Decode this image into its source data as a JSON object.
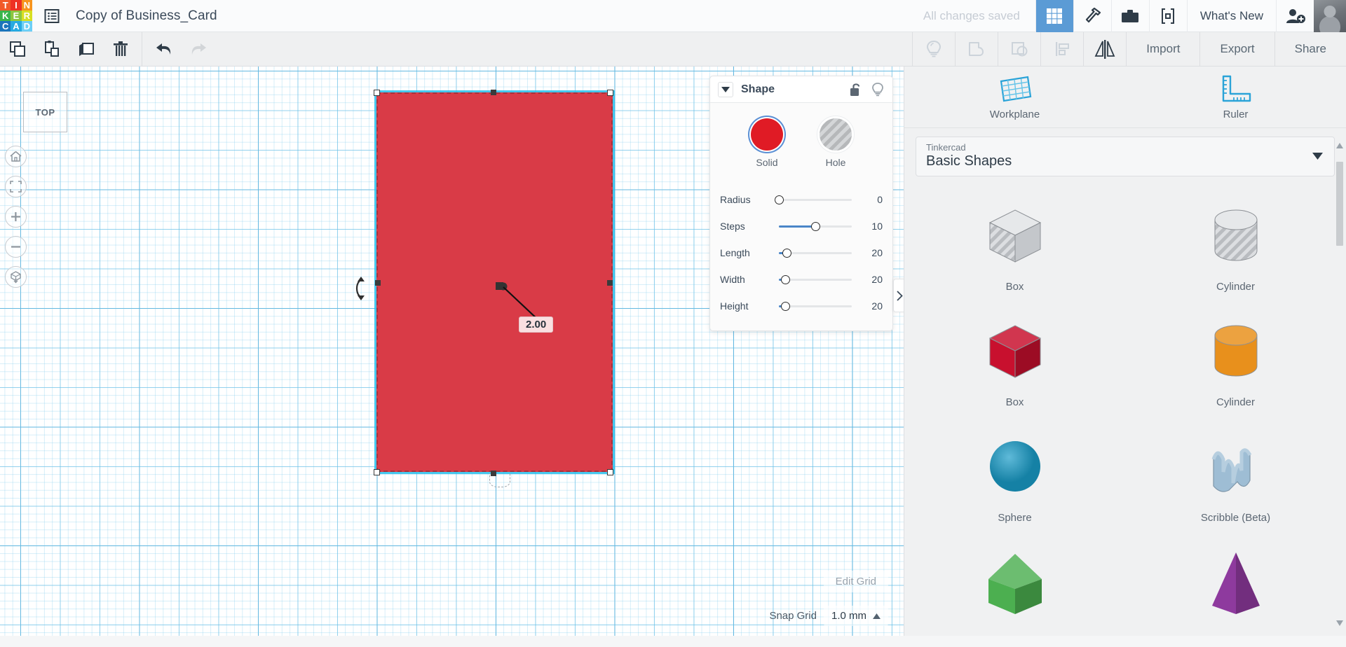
{
  "header": {
    "logo_tiles": [
      {
        "letter": "T",
        "color": "#f15a29"
      },
      {
        "letter": "I",
        "color": "#ee3124"
      },
      {
        "letter": "N",
        "color": "#f7941e"
      },
      {
        "letter": "K",
        "color": "#39b54a"
      },
      {
        "letter": "E",
        "color": "#8cc63f"
      },
      {
        "letter": "R",
        "color": "#d7df23"
      },
      {
        "letter": "C",
        "color": "#1b75bb"
      },
      {
        "letter": "A",
        "color": "#27aae1"
      },
      {
        "letter": "D",
        "color": "#6dcff6"
      }
    ],
    "menu_icon": "list-menu-icon",
    "title": "Copy of Business_Card",
    "save_status": "All changes saved",
    "buttons": [
      {
        "name": "grid-view-button",
        "icon": "grid-icon",
        "active": true
      },
      {
        "name": "codeblocks-button",
        "icon": "hammer-icon",
        "active": false
      },
      {
        "name": "gallery-button",
        "icon": "briefcase-icon",
        "active": false
      },
      {
        "name": "blocks-button",
        "icon": "code-brackets-icon",
        "active": false
      }
    ],
    "whats_new": "What's New",
    "invite_icon": "add-person-icon",
    "avatar": "user-avatar"
  },
  "toolbar": {
    "left_buttons": [
      {
        "name": "copy-button",
        "icon": "copy-icon"
      },
      {
        "name": "paste-button",
        "icon": "paste-icon"
      },
      {
        "name": "duplicate-button",
        "icon": "duplicate-icon"
      },
      {
        "name": "delete-button",
        "icon": "trash-icon"
      }
    ],
    "history_buttons": [
      {
        "name": "undo-button",
        "icon": "undo-arrow-icon"
      },
      {
        "name": "redo-button",
        "icon": "redo-arrow-icon"
      }
    ],
    "right_icon_buttons": [
      {
        "name": "light-button",
        "icon": "lightbulb-icon"
      },
      {
        "name": "group-button",
        "icon": "group-shapes-icon"
      },
      {
        "name": "ungroup-button",
        "icon": "ungroup-shapes-icon"
      },
      {
        "name": "align-button",
        "icon": "align-icon"
      },
      {
        "name": "mirror-button",
        "icon": "mirror-icon"
      }
    ],
    "text_buttons": [
      {
        "name": "import-button",
        "label": "Import"
      },
      {
        "name": "export-button",
        "label": "Export"
      },
      {
        "name": "share-button",
        "label": "Share"
      }
    ]
  },
  "canvas": {
    "view_cube_label": "TOP",
    "nav_buttons": [
      {
        "name": "home-view-button",
        "icon": "home-icon"
      },
      {
        "name": "fit-view-button",
        "icon": "fit-frame-icon"
      },
      {
        "name": "zoom-in-button",
        "icon": "plus-icon"
      },
      {
        "name": "zoom-out-button",
        "icon": "minus-icon"
      },
      {
        "name": "ortho-perspective-button",
        "icon": "cube-arrow-icon"
      }
    ],
    "shape": {
      "name": "selected-box-shape",
      "fill_color": "#d93b47",
      "selection_color": "#28beeb",
      "dimension_value": "2.00",
      "rotate_handle": "rotate-handle-icon"
    },
    "edit_grid_label": "Edit Grid",
    "snap_grid_label": "Snap Grid",
    "snap_grid_value": "1.0 mm"
  },
  "shape_panel": {
    "title": "Shape",
    "collapse_icon": "caret-down-icon",
    "lock_icon": "unlocked-padlock-icon",
    "light_icon": "lightbulb-icon",
    "swatches": [
      {
        "name": "solid-swatch",
        "label": "Solid",
        "color": "#e01b25",
        "selected": true
      },
      {
        "name": "hole-swatch",
        "label": "Hole",
        "color": "#c4c6c8",
        "selected": false
      }
    ],
    "sliders": [
      {
        "name": "radius-slider",
        "label": "Radius",
        "value": "0",
        "percent": 0
      },
      {
        "name": "steps-slider",
        "label": "Steps",
        "value": "10",
        "percent": 44
      },
      {
        "name": "length-slider",
        "label": "Length",
        "value": "20",
        "percent": 9
      },
      {
        "name": "width-slider",
        "label": "Width",
        "value": "20",
        "percent": 8
      },
      {
        "name": "height-slider",
        "label": "Height",
        "value": "20",
        "percent": 8
      }
    ]
  },
  "sidebar": {
    "tools": [
      {
        "name": "workplane-tool",
        "label": "Workplane",
        "icon": "workplane-grid-icon"
      },
      {
        "name": "ruler-tool",
        "label": "Ruler",
        "icon": "ruler-icon"
      }
    ],
    "library": {
      "provider": "Tinkercad",
      "collection": "Basic Shapes",
      "caret": "caret-down-icon"
    },
    "shapes": [
      {
        "name": "shape-box-hole",
        "label": "Box",
        "kind": "box",
        "color": "#c9ccd0",
        "hole": true
      },
      {
        "name": "shape-cylinder-hole",
        "label": "Cylinder",
        "kind": "cylinder",
        "color": "#c9ccd0",
        "hole": true
      },
      {
        "name": "shape-box-solid",
        "label": "Box",
        "kind": "box",
        "color": "#c8102e",
        "hole": false
      },
      {
        "name": "shape-cylinder-solid",
        "label": "Cylinder",
        "kind": "cylinder",
        "color": "#e8901c",
        "hole": false
      },
      {
        "name": "shape-sphere",
        "label": "Sphere",
        "kind": "sphere",
        "color": "#1a9dc9",
        "hole": false
      },
      {
        "name": "shape-scribble",
        "label": "Scribble (Beta)",
        "kind": "scribble",
        "color": "#9ebdd4",
        "hole": false
      },
      {
        "name": "shape-roof",
        "label": "",
        "kind": "roof",
        "color": "#4caf50",
        "hole": false
      },
      {
        "name": "shape-pyramid",
        "label": "",
        "kind": "pyramid",
        "color": "#8e3a9e",
        "hole": false
      }
    ],
    "scroll": {
      "up_arrow": "triangle-up-icon",
      "down_arrow": "triangle-down-icon"
    }
  }
}
